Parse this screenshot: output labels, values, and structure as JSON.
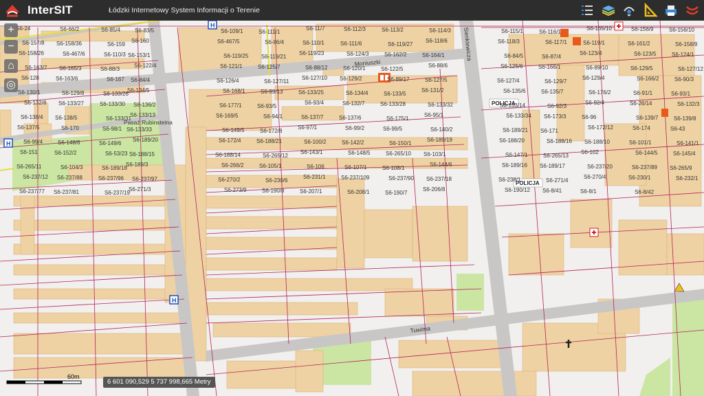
{
  "header": {
    "brand": "InterSIT",
    "subtitle": "Łódzki Internetowy System Informacji o Terenie",
    "tools": [
      "list-icon",
      "layers-icon",
      "gps-icon",
      "measure-icon",
      "print-icon",
      "logo-small-icon"
    ]
  },
  "controls": {
    "zoom_in": "+",
    "zoom_out": "−",
    "home": "⌂",
    "locate": "◎"
  },
  "map": {
    "scale_label": "60m",
    "coordinates": "6 601 090,529 5 737 998,665 Metry",
    "streets": [
      "Moniuszki",
      "Sienkiewicza",
      "Tuwima",
      "Pasaż Rubinsteina"
    ],
    "police_labels": [
      "POLICJA",
      "POLICJA"
    ],
    "parcels": [
      "S6-24",
      "S6-66/2",
      "S6-85/4",
      "S6-83/5",
      "S6-109/1",
      "S6-111/1",
      "S6-11/7",
      "S6-112/3",
      "S6-113/2",
      "S6-114/3",
      "S6-115/1",
      "S6-116/1",
      "S6-165/10",
      "S6-156/9",
      "S6-156/10",
      "S6-157/8",
      "S6-158/36",
      "S6-159",
      "S6-160",
      "S6-467/5",
      "S6-86/4",
      "S6-110/1",
      "S6-111/6",
      "S6-119/27",
      "S6-118/6",
      "S6-118/3",
      "S6-117/1",
      "S6-119/1",
      "S6-161/2",
      "S6-158/9",
      "S6-158/26",
      "S6-467/6",
      "S6-110/3",
      "S6-153/1",
      "S6-119/25",
      "S6-119/21",
      "S6-119/23",
      "S6-124/3",
      "S6-162/2",
      "S6-164/1",
      "S6-84/5",
      "S6-87/4",
      "S6-123/4",
      "S6-123/5",
      "S6-124/1",
      "S6-163/7",
      "S6-165/3",
      "S6-88/3",
      "S6-122/4",
      "S6-121/1",
      "S6-125/7",
      "S6-88/12",
      "S6-120/1",
      "S6-122/5",
      "S6-88/6",
      "S6-125/6",
      "S6-166/1",
      "S6-89/10",
      "S6-129/5",
      "S6-127/12",
      "S6-128",
      "S6-163/6",
      "S6-167",
      "S6-84/4",
      "S6-126/4",
      "S6-127/11",
      "S6-127/10",
      "S6-129/2",
      "S6-89/17",
      "S6-127/5",
      "S6-127/4",
      "S6-129/7",
      "S6-129/4",
      "S6-166/2",
      "S6-90/3",
      "S6-130/1",
      "S6-129/8",
      "S6-133/26",
      "S6-134/5",
      "S6-168/1",
      "S6-89/13",
      "S6-133/25",
      "S6-134/4",
      "S6-133/5",
      "S6-131/2",
      "S6-135/6",
      "S6-135/7",
      "S6-176/2",
      "S6-91/1",
      "S6-93/1",
      "S6-132/8",
      "S6-133/27",
      "S6-133/30",
      "S6-136/2",
      "S6-177/1",
      "S6-93/5",
      "S6-93/4",
      "S6-132/7",
      "S6-133/28",
      "S6-133/32",
      "S6-133/14",
      "S6-92/3",
      "S6-92/4",
      "S6-26/14",
      "S6-132/3",
      "S6-138/4",
      "S6-138/5",
      "S6-133/31",
      "S6-133/13",
      "S6-169/5",
      "S6-94/1",
      "S6-137/7",
      "S6-137/6",
      "S6-175/1",
      "S6-95/1",
      "S6-133/34",
      "S6-173/3",
      "S6-96",
      "S6-139/7",
      "S6-139/8",
      "S6-137/5",
      "S6-170",
      "S6-98/1",
      "S6-133/33",
      "S6-149/5",
      "S6-172/8",
      "S6-97/1",
      "S6-99/2",
      "S6-99/5",
      "S6-140/2",
      "S6-189/21",
      "S6-171",
      "S6-172/12",
      "S6-174",
      "S6-43",
      "S6-99/4",
      "S6-148/6",
      "S6-149/6",
      "S6-189/20",
      "S6-172/4",
      "S6-188/21",
      "S6-100/2",
      "S6-142/2",
      "S6-150/1",
      "S6-189/19",
      "S6-188/20",
      "S6-188/16",
      "S6-188/10",
      "S6-101/1",
      "S6-141/1",
      "S6-151",
      "S6-152/2",
      "S6-53/23",
      "S6-188/15",
      "S6-188/14",
      "S6-265/12",
      "S6-143/1",
      "S6-148/5",
      "S6-265/10",
      "S6-103/1",
      "S6-147/1",
      "S6-265/13",
      "S6-102",
      "S6-144/5",
      "S6-145/4",
      "S6-265/11",
      "S6-104/3",
      "S6-189/18",
      "S6-189/3",
      "S6-266/2",
      "S6-105/1",
      "S6-106",
      "S6-107/1",
      "S6-108/1",
      "S6-144/6",
      "S6-189/16",
      "S6-189/17",
      "S6-237/20",
      "S6-237/89",
      "S6-265/9",
      "S6-237/12",
      "S6-237/88",
      "S6-237/96",
      "S6-237/97",
      "S6-270/2",
      "S6-230/6",
      "S6-231/1",
      "S6-237/109",
      "S6-237/90",
      "S6-237/18",
      "S6-238/1",
      "S6-271/4",
      "S6-270/4",
      "S6-230/1",
      "S6-232/1",
      "S6-237/77",
      "S6-237/81",
      "S6-237/19",
      "S6-271/3",
      "S6-273/9",
      "S6-190/8",
      "S6-207/1",
      "S6-208/1",
      "S6-190/7",
      "S6-206/8",
      "S6-190/12",
      "S6-8/41",
      "S6-8/1",
      "S6-8/42"
    ]
  }
}
